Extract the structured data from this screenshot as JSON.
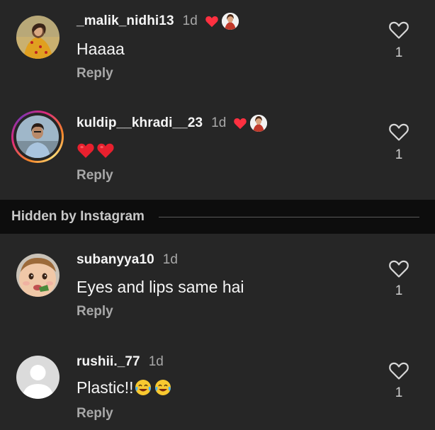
{
  "colors": {
    "background": "#262626",
    "like_heart": "#ff3040",
    "hidden_bar": "#0d0d0d",
    "reply_text": "#a8a8a8"
  },
  "comments": [
    {
      "username": "_malik_nidhi13",
      "time": "1d",
      "text": "Haaaa",
      "reply_label": "Reply",
      "like_count": "1",
      "liked_by_creator": true,
      "avatar": "avatar-girl-yellow-dress"
    },
    {
      "username": "kuldip__khradi__23",
      "time": "1d",
      "text": "",
      "emojis": [
        "red-heart-icon",
        "red-heart-icon"
      ],
      "reply_label": "Reply",
      "like_count": "1",
      "liked_by_creator": true,
      "avatar": "avatar-man-story-ring"
    },
    {
      "username": "subanyya10",
      "time": "1d",
      "text": "Eyes and lips same hai",
      "reply_label": "Reply",
      "like_count": "1",
      "liked_by_creator": false,
      "avatar": "avatar-baby"
    },
    {
      "username": "rushii._77",
      "time": "1d",
      "text": "Plastic!!",
      "emojis": [
        "laughing-tears-icon",
        "laughing-tears-icon"
      ],
      "reply_label": "Reply",
      "like_count": "1",
      "liked_by_creator": false,
      "avatar": "avatar-default"
    }
  ],
  "hidden_section": {
    "label": "Hidden by Instagram"
  }
}
